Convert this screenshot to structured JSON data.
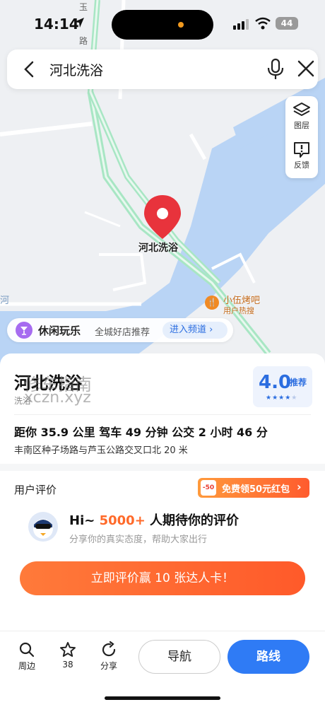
{
  "status_bar": {
    "time": "14:14",
    "battery": "44"
  },
  "search": {
    "query": "河北洗浴"
  },
  "side_tools": [
    {
      "label": "图层",
      "icon": "layers-icon"
    },
    {
      "label": "反馈",
      "icon": "feedback-icon"
    }
  ],
  "map": {
    "pin_label": "河北洗浴",
    "poi_name": "小伍烤吧",
    "poi_tag": "用户热搜",
    "river_label": "河",
    "road_char_1": "玉",
    "road_char_2": "路"
  },
  "leisure": {
    "title": "休闲玩乐",
    "subtitle": "全城好店推荐",
    "button": "进入频道"
  },
  "place": {
    "title": "河北洗浴",
    "category": "洗浴",
    "watermark_line1": "修车指南",
    "watermark_line2": "xczn.xyz",
    "score": "4.0",
    "score_tag": "推荐",
    "route_info": "距你 35.9 公里   驾车 49 分钟   公交 2 小时 46 分",
    "address": "丰南区种子场路与芦玉公路交叉口北 20 米"
  },
  "reviews": {
    "heading": "用户评价",
    "coupon_badge": "-50",
    "coupon_text": "免费领50元红包",
    "hi_prefix": "Hi~ ",
    "hi_count": "5000+",
    "hi_suffix": " 人期待你的评价",
    "sub": "分享你的真实态度，帮助大家出行",
    "cta": "立即评价赢 10 张达人卡！"
  },
  "bottom_bar": {
    "nearby": "周边",
    "favorites": "38",
    "share": "分享",
    "navigate": "导航",
    "route": "路线"
  },
  "colors": {
    "accent": "#2f7bf5",
    "orange": "#ff6a2a",
    "river": "#b9d4f5",
    "road": "#a8e6c4"
  }
}
